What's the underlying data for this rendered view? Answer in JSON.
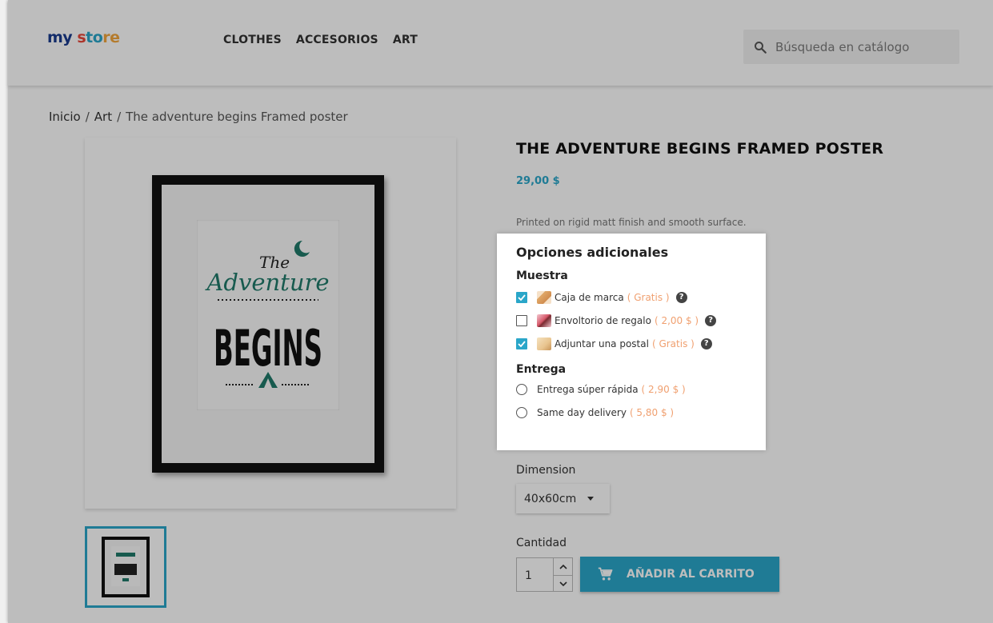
{
  "header": {
    "logo": {
      "part1": "my",
      "part2": "s",
      "part3": "to",
      "part4": "re"
    },
    "nav": [
      "CLOTHES",
      "ACCESORIOS",
      "ART"
    ],
    "search_placeholder": "Búsqueda en catálogo"
  },
  "breadcrumb": {
    "items": [
      "Inicio",
      "Art"
    ],
    "current": "The adventure begins Framed poster",
    "separator": "/"
  },
  "poster": {
    "line1": "The",
    "line2": "Adventure",
    "line3": "BEGINS"
  },
  "product": {
    "title": "THE ADVENTURE BEGINS FRAMED POSTER",
    "price": "29,00 $",
    "description": "Printed on rigid matt finish and smooth surface."
  },
  "options": {
    "title": "Opciones adicionales",
    "groups": [
      {
        "title": "Muestra",
        "items": [
          {
            "label": "Caja de marca",
            "price": "( Gratis )",
            "checked": true
          },
          {
            "label": "Envoltorio de regalo",
            "price": "( 2,00 $ )",
            "checked": false
          },
          {
            "label": "Adjuntar una postal",
            "price": "( Gratis )",
            "checked": true
          }
        ]
      },
      {
        "title": "Entrega",
        "items": [
          {
            "label": "Entrega súper rápida",
            "price": "( 2,90 $ )",
            "selected": false
          },
          {
            "label": "Same day delivery",
            "price": "( 5,80 $ )",
            "selected": false
          }
        ]
      }
    ],
    "help_glyph": "?"
  },
  "variants": {
    "dimension_label": "Dimension",
    "dimension_value": "40x60cm",
    "quantity_label": "Cantidad",
    "quantity_value": "1",
    "add_to_cart": "AÑADIR AL CARRITO"
  },
  "colors": {
    "accent": "#2aa6c9",
    "price_tag": "#f0a070",
    "poster_green": "#1f7a6a"
  }
}
